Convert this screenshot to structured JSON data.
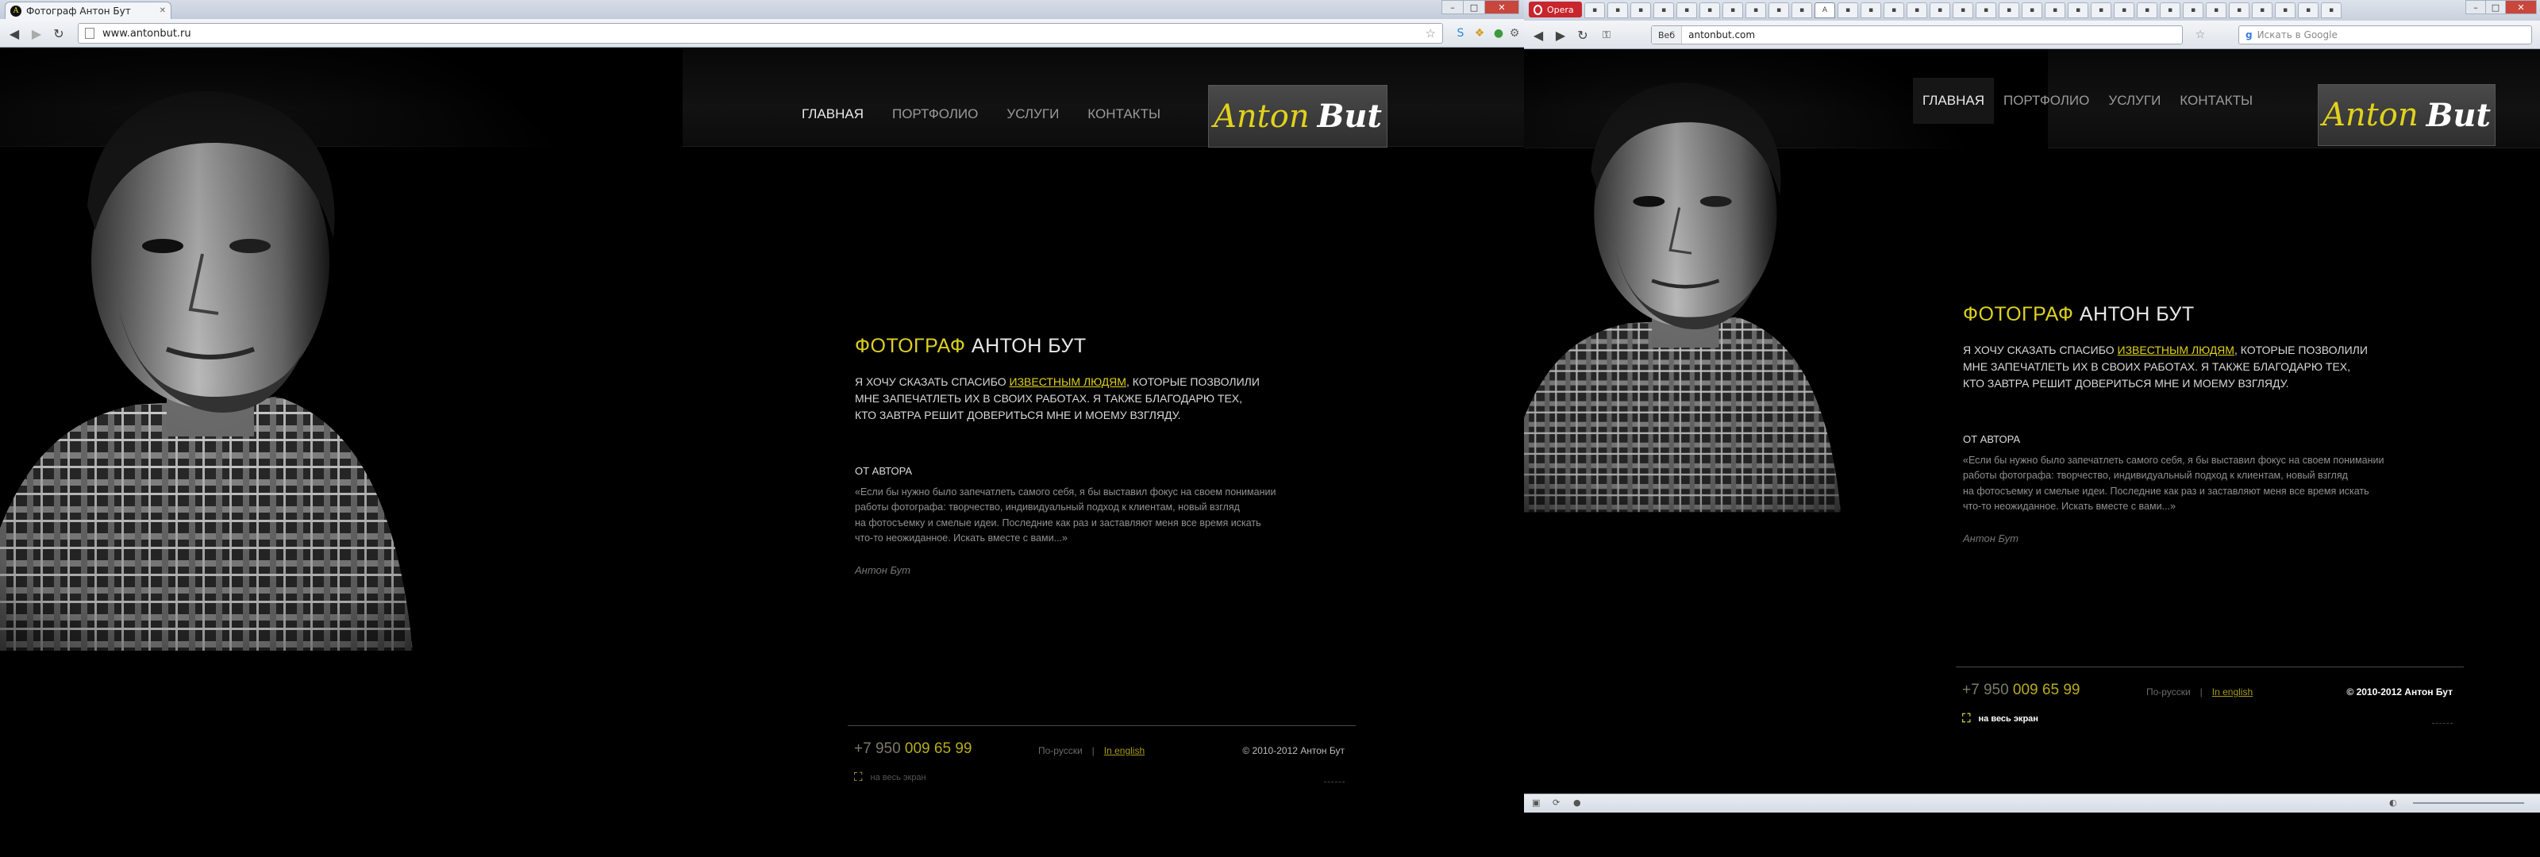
{
  "chrome": {
    "tab_title": "Фотограф Антон Бут",
    "url": "www.antonbut.ru"
  },
  "opera": {
    "menu_label": "Opera",
    "web_label": "Веб",
    "url": "antonbut.com",
    "search_placeholder": "Искать в Google"
  },
  "site": {
    "nav": [
      "ГЛАВНАЯ",
      "ПОРТФОЛИО",
      "УСЛУГИ",
      "КОНТАКТЫ"
    ],
    "logo_first": "Anton",
    "logo_last": "But",
    "heading_accent": "ФОТОГРАФ",
    "heading_name": "АНТОН БУТ",
    "intro_before": "Я ХОЧУ СКАЗАТЬ СПАСИБО ",
    "intro_link": "ИЗВЕСТНЫМ ЛЮДЯМ",
    "intro_line1_end": ", КОТОРЫЕ ПОЗВОЛИЛИ",
    "intro_line2": "МНЕ ЗАПЕЧАТЛЕТЬ ИХ В СВОИХ РАБОТАХ. Я ТАКЖЕ БЛАГОДАРЮ ТЕХ,",
    "intro_line3": "КТО ЗАВТРА РЕШИТ ДОВЕРИТЬСЯ МНЕ И МОЕМУ ВЗГЛЯДУ.",
    "author_heading": "ОТ АВТОРА",
    "quote_line1": "«Если бы нужно было запечатлеть самого себя, я бы выставил фокус на своем понимании",
    "quote_line2": "работы фотографа: творчество, индивидуальный подход к клиентам, новый взгляд",
    "quote_line3": "на фотосъемку и смелые идеи. Последние как раз и заставляют меня все время искать",
    "quote_line4": "что-то неожиданное. Искать вместе с вами...»",
    "signature": "Антон Бут",
    "phone_prefix": "+7 950 ",
    "phone_number": "009 65 99",
    "lang_ru": "По-русски",
    "lang_sep": "|",
    "lang_en": "In english",
    "copyright": "© 2010-2012 Антон Бут",
    "fullscreen": "на весь экран"
  },
  "colors": {
    "accent_yellow": "#ddd11f",
    "background": "#000000",
    "opera_red": "#c8252d"
  }
}
